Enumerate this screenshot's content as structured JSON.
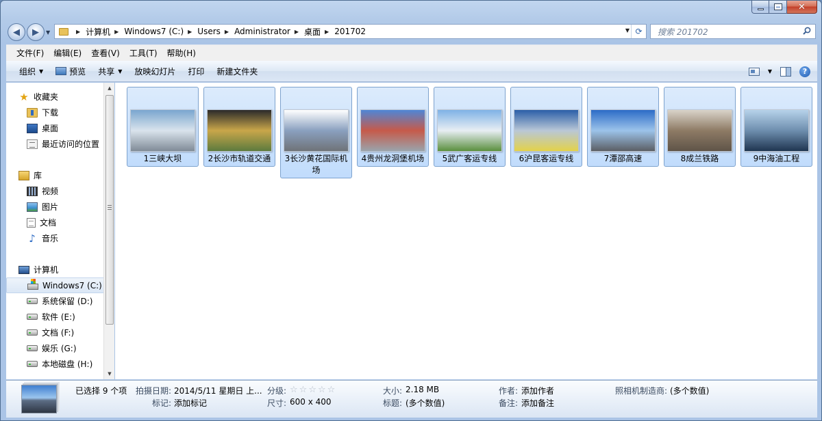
{
  "address": {
    "crumbs": [
      "计算机",
      "Windows7 (C:)",
      "Users",
      "Administrator",
      "桌面",
      "201702"
    ]
  },
  "search": {
    "placeholder": "搜索 201702"
  },
  "menu": [
    "文件(F)",
    "编辑(E)",
    "查看(V)",
    "工具(T)",
    "帮助(H)"
  ],
  "toolbar": {
    "organize": "组织",
    "preview": "预览",
    "share": "共享",
    "slideshow": "放映幻灯片",
    "print": "打印",
    "new_folder": "新建文件夹"
  },
  "nav": {
    "favorites": {
      "label": "收藏夹",
      "items": [
        "下载",
        "桌面",
        "最近访问的位置"
      ]
    },
    "libraries": {
      "label": "库",
      "items": [
        "视频",
        "图片",
        "文档",
        "音乐"
      ]
    },
    "computer": {
      "label": "计算机",
      "items": [
        "Windows7 (C:)",
        "系统保留 (D:)",
        "软件 (E:)",
        "文档 (F:)",
        "娱乐 (G:)",
        "本地磁盘 (H:)"
      ]
    }
  },
  "files": [
    {
      "name": "1三峡大坝",
      "colors": [
        "#7aa6cf",
        "#d9e3ec",
        "#7f8b97"
      ]
    },
    {
      "name": "2长沙市轨道交通",
      "colors": [
        "#2a2a2a",
        "#c9a64a",
        "#5c7b3e"
      ]
    },
    {
      "name": "3长沙黄花国际机场",
      "colors": [
        "#ffffff",
        "#8aa0bf",
        "#6f7378"
      ]
    },
    {
      "name": "4贵州龙洞堡机场",
      "colors": [
        "#4f86d6",
        "#c65a4a",
        "#9aa4ac"
      ]
    },
    {
      "name": "5武广客运专线",
      "colors": [
        "#7fb2e6",
        "#e8eef3",
        "#5a8f3e"
      ]
    },
    {
      "name": "6沪昆客运专线",
      "colors": [
        "#2b5fa8",
        "#b9c7d6",
        "#e3d24a"
      ]
    },
    {
      "name": "7潭邵高速",
      "colors": [
        "#2c6cc7",
        "#9cc3ea",
        "#5b5e64"
      ]
    },
    {
      "name": "8成兰铁路",
      "colors": [
        "#d9d3c9",
        "#8e7b65",
        "#5f5448"
      ]
    },
    {
      "name": "9中海油工程",
      "colors": [
        "#b6d2ea",
        "#6e8eae",
        "#1f3550"
      ]
    }
  ],
  "details": {
    "selected_count": "已选择 9 个项",
    "date_taken_key": "拍摄日期:",
    "date_taken_val": "2014/5/11 星期日 上...",
    "rating_key": "分级:",
    "rating_stars": 0,
    "size_key": "大小:",
    "size_val": "2.18 MB",
    "author_key": "作者:",
    "author_val": "添加作者",
    "maker_key": "照相机制造商:",
    "maker_val": "(多个数值)",
    "tags_key": "标记:",
    "tags_val": "添加标记",
    "dims_key": "尺寸:",
    "dims_val": "600 x 400",
    "title_key": "标题:",
    "title_val": "(多个数值)",
    "notes_key": "备注:",
    "notes_val": "添加备注"
  }
}
